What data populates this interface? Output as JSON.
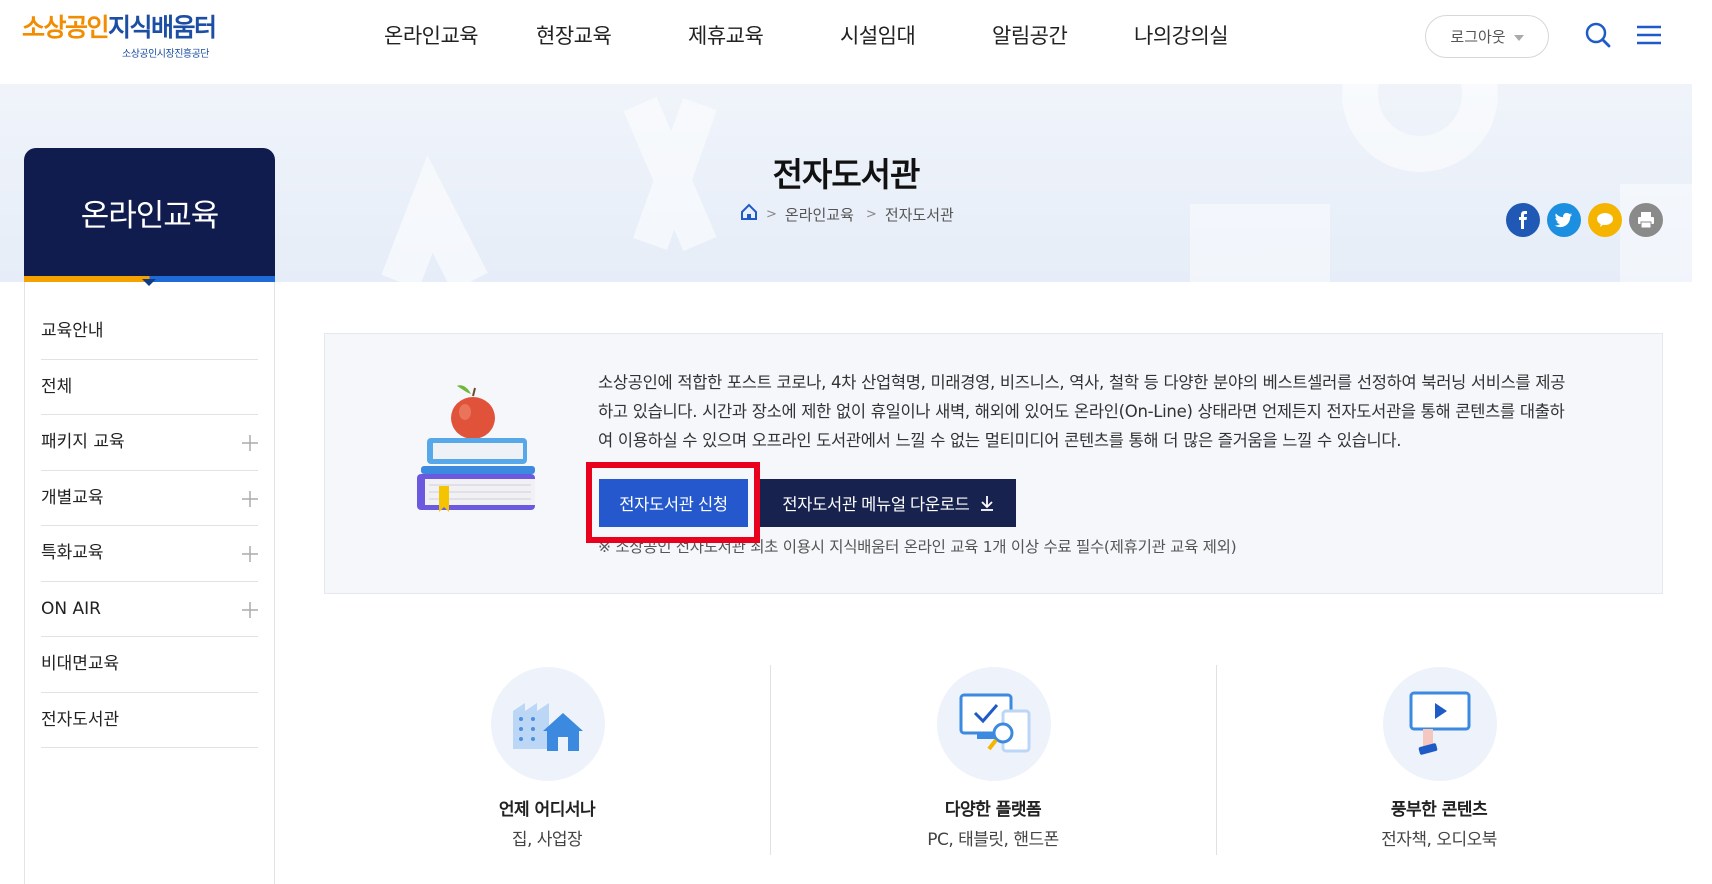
{
  "header": {
    "logo_part1": "소상공인",
    "logo_part2": "지식배움터",
    "logo_sub": "소상공인시장진흥공단",
    "nav": [
      "온라인교육",
      "현장교육",
      "제휴교육",
      "시설임대",
      "알림공간",
      "나의강의실"
    ],
    "logout_label": "로그아웃",
    "search_icon": "search-icon",
    "menu_icon": "hamburger-menu-icon"
  },
  "hero": {
    "title": "전자도서관",
    "breadcrumb": [
      "온라인교육",
      "전자도서관"
    ]
  },
  "share": {
    "facebook_color": "#1f58b5",
    "twitter_color": "#1d8fe1",
    "talk_color": "#f5b400",
    "print_color": "#8a8a8a"
  },
  "sidebar": {
    "title": "온라인교육",
    "items": [
      {
        "label": "교육안내",
        "expandable": false
      },
      {
        "label": "전체",
        "expandable": false
      },
      {
        "label": "패키지 교육",
        "expandable": true
      },
      {
        "label": "개별교육",
        "expandable": true
      },
      {
        "label": "특화교육",
        "expandable": true
      },
      {
        "label": "ON AIR",
        "expandable": true
      },
      {
        "label": "비대면교육",
        "expandable": false
      },
      {
        "label": "전자도서관",
        "expandable": false
      }
    ]
  },
  "intro": {
    "line1": "소상공인에 적합한 포스트 코로나, 4차 산업혁명, 미래경영, 비즈니스, 역사, 철학 등 다양한 분야의 베스트셀러를 선정하여 북러닝 서비스를 제공",
    "line2": "하고 있습니다. 시간과 장소에 제한 없이 휴일이나 새벽, 해외에 있어도 온라인(On-Line) 상태라면 언제든지 전자도서관을 통해 콘텐츠를 대출하",
    "line3": "여 이용하실 수 있으며 오프라인 도서관에서 느낄 수 없는 멀티미디어 콘텐츠를 통해 더 많은 즐거움을 느낄 수 있습니다.",
    "apply_button": "전자도서관 신청",
    "manual_button": "전자도서관 메뉴얼 다운로드",
    "note": "※ 소상공인 전자도서관 최초 이용시 지식배움터 온라인 교육 1개 이상 수료 필수(제휴기관 교육 제외)",
    "highlight_color": "#e8001c"
  },
  "features": [
    {
      "title": "언제 어디서나",
      "sub": "집, 사업장",
      "icon": "building-home-icon"
    },
    {
      "title": "다양한 플랫폼",
      "sub": "PC, 태블릿, 핸드폰",
      "icon": "devices-icon"
    },
    {
      "title": "풍부한 콘텐츠",
      "sub": "전자책, 오디오북",
      "icon": "video-screen-icon"
    }
  ]
}
